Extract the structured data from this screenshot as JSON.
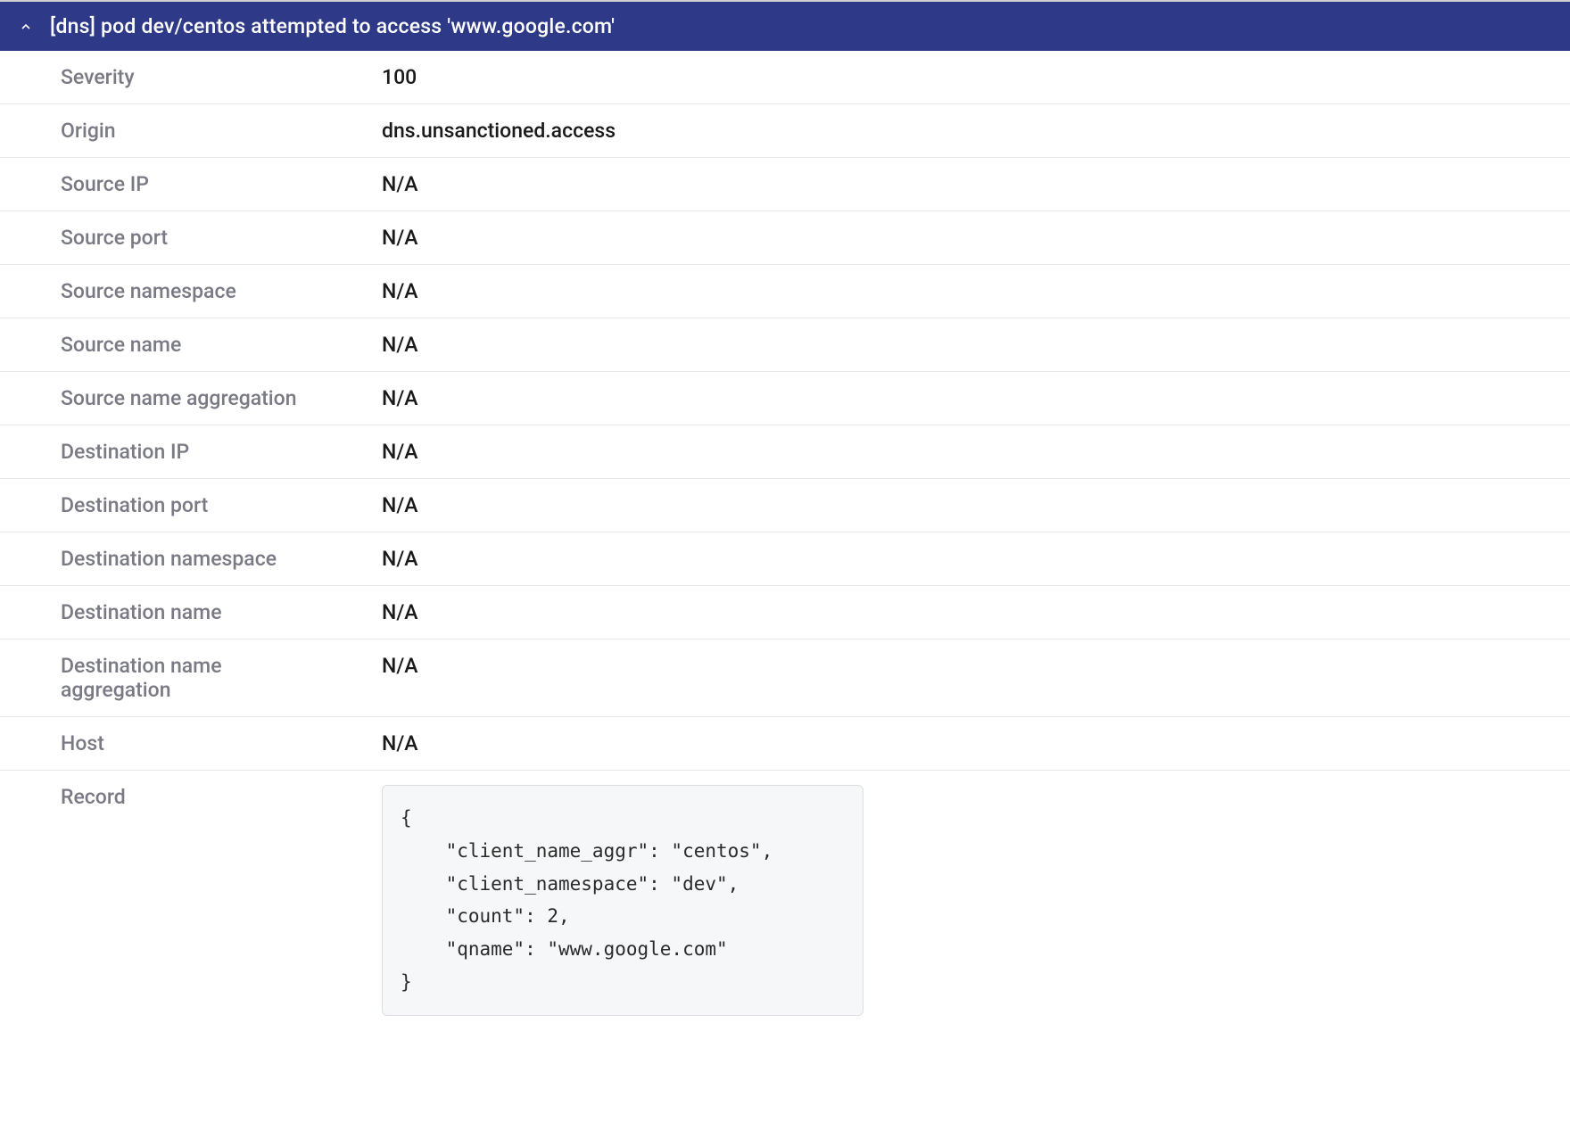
{
  "header": {
    "title": "[dns] pod dev/centos attempted to access 'www.google.com'"
  },
  "details": {
    "severity_label": "Severity",
    "severity_value": "100",
    "origin_label": "Origin",
    "origin_value": "dns.unsanctioned.access",
    "source_ip_label": "Source IP",
    "source_ip_value": "N/A",
    "source_port_label": "Source port",
    "source_port_value": "N/A",
    "source_namespace_label": "Source namespace",
    "source_namespace_value": "N/A",
    "source_name_label": "Source name",
    "source_name_value": "N/A",
    "source_name_agg_label": "Source name aggregation",
    "source_name_agg_value": "N/A",
    "dest_ip_label": "Destination IP",
    "dest_ip_value": "N/A",
    "dest_port_label": "Destination port",
    "dest_port_value": "N/A",
    "dest_namespace_label": "Destination namespace",
    "dest_namespace_value": "N/A",
    "dest_name_label": "Destination name",
    "dest_name_value": "N/A",
    "dest_name_agg_label": "Destination name aggregation",
    "dest_name_agg_value": "N/A",
    "host_label": "Host",
    "host_value": "N/A",
    "record_label": "Record",
    "record_value": "{\n    \"client_name_aggr\": \"centos\",\n    \"client_namespace\": \"dev\",\n    \"count\": 2,\n    \"qname\": \"www.google.com\"\n}"
  }
}
